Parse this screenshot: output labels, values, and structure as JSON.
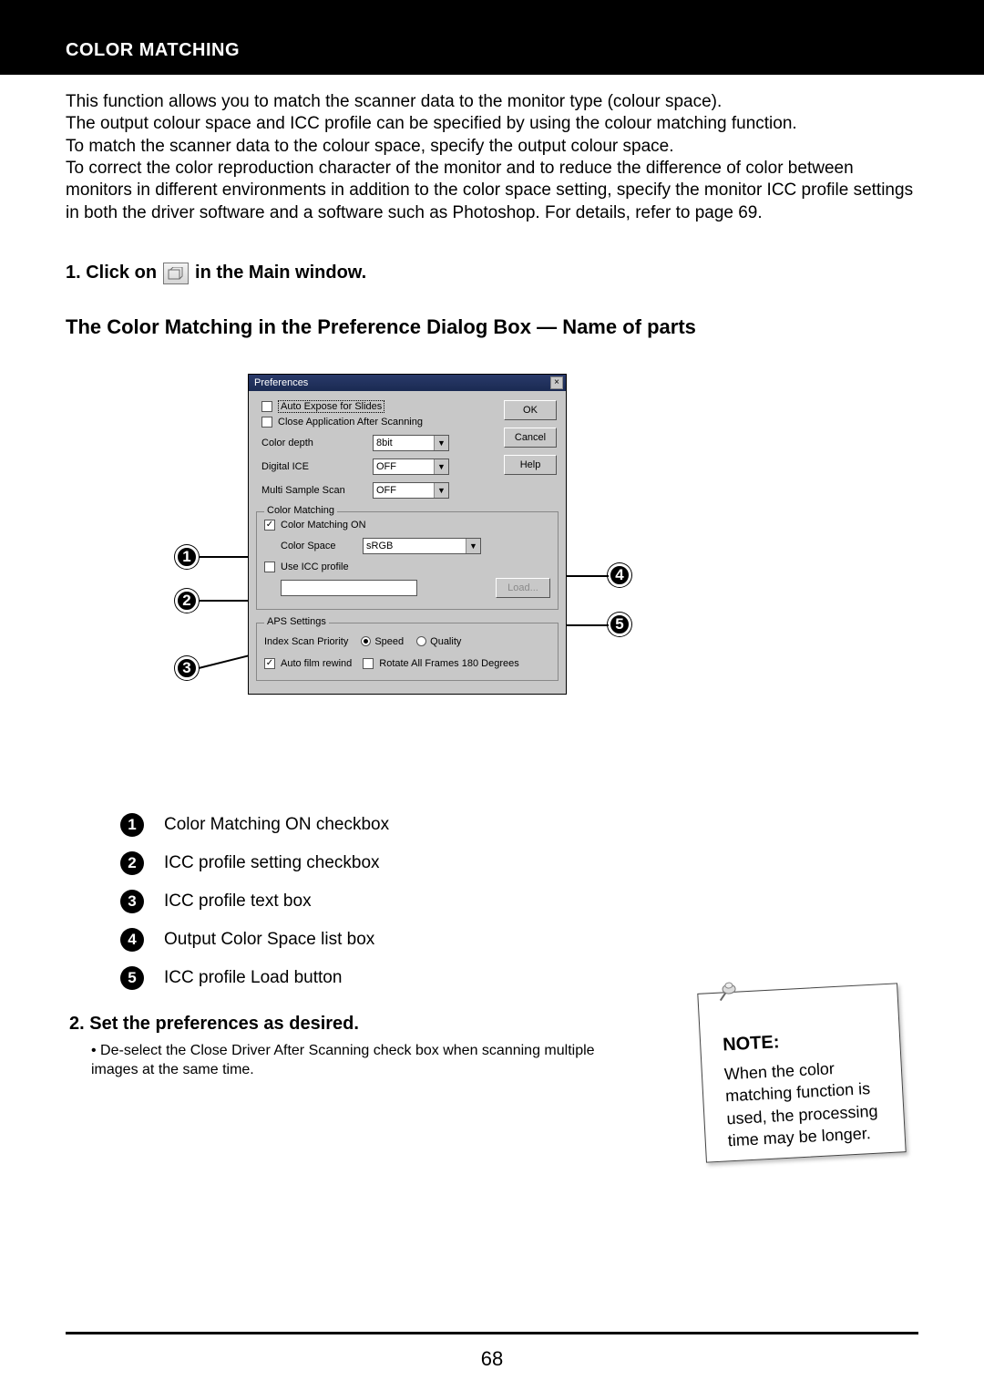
{
  "header": {
    "section_title": "COLOR MATCHING"
  },
  "intro": {
    "p1": "This function allows you to match the scanner data to the monitor type (colour space).",
    "p2": "The output colour space and ICC profile can be specified by using the colour matching function.",
    "p3": "To match the scanner data to the colour space, specify the output colour space.",
    "p4": "To correct the color reproduction character of the monitor and to reduce the difference of color between monitors in different environments in addition to the color space setting, specify the monitor ICC profile settings in both the driver software and a software such as Photoshop. For details, refer to page 69."
  },
  "step1": {
    "prefix": "1.  Click on",
    "suffix": "in the Main window."
  },
  "subheading": "The Color Matching in the Preference Dialog Box — Name of parts",
  "dialog": {
    "title": "Preferences",
    "buttons": {
      "ok": "OK",
      "cancel": "Cancel",
      "help": "Help",
      "load": "Load..."
    },
    "general": {
      "auto_expose_label": "Auto Expose for Slides",
      "auto_expose_checked": false,
      "close_after_label": "Close Application After Scanning",
      "close_after_checked": false,
      "color_depth_label": "Color depth",
      "color_depth_value": "8bit",
      "digital_ice_label": "Digital ICE",
      "digital_ice_value": "OFF",
      "multi_sample_label": "Multi Sample Scan",
      "multi_sample_value": "OFF"
    },
    "color_matching": {
      "group_label": "Color Matching",
      "on_label": "Color Matching ON",
      "on_checked": true,
      "color_space_label": "Color Space",
      "color_space_value": "sRGB",
      "use_icc_label": "Use ICC profile",
      "use_icc_checked": false
    },
    "aps": {
      "group_label": "APS Settings",
      "index_priority_label": "Index Scan Priority",
      "speed_label": "Speed",
      "quality_label": "Quality",
      "speed_selected": true,
      "auto_rewind_label": "Auto film rewind",
      "auto_rewind_checked": true,
      "rotate_label": "Rotate All Frames 180 Degrees",
      "rotate_checked": false
    }
  },
  "legend": {
    "items": [
      {
        "n": "1",
        "text": "Color Matching ON checkbox"
      },
      {
        "n": "2",
        "text": "ICC profile setting checkbox"
      },
      {
        "n": "3",
        "text": "ICC profile text box"
      },
      {
        "n": "4",
        "text": "Output Color Space list box"
      },
      {
        "n": "5",
        "text": "ICC profile Load button"
      }
    ]
  },
  "step2": {
    "heading": "2.  Set the preferences as desired.",
    "bullet": "De-select the Close Driver After Scanning check box when scanning multiple images at the same time."
  },
  "note": {
    "title": "NOTE:",
    "body": "When the color matching function is used, the processing time may be longer."
  },
  "page_number": "68"
}
